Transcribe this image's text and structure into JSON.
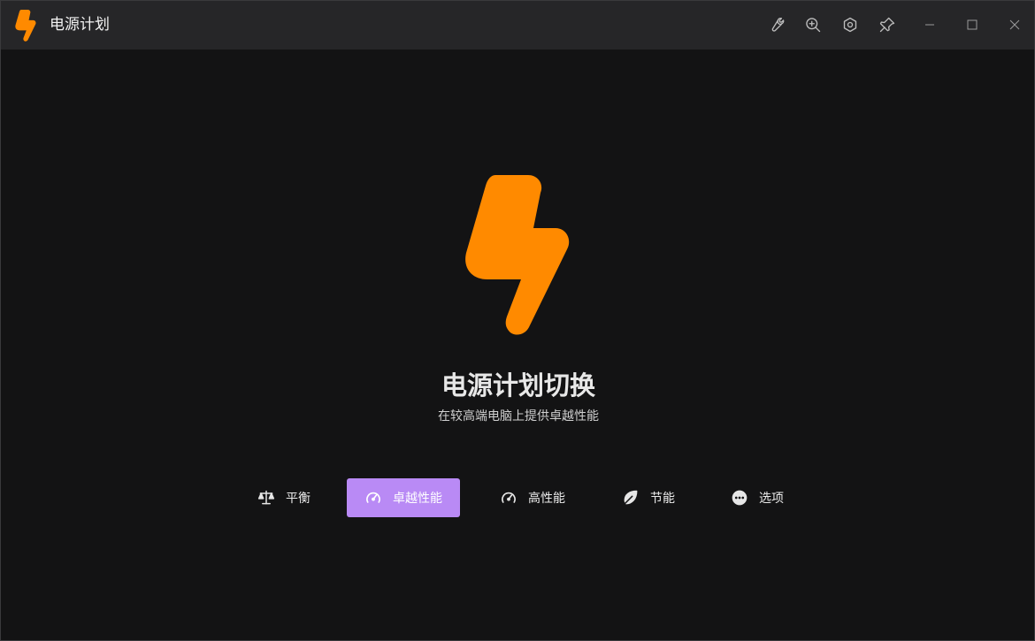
{
  "window": {
    "title": "电源计划",
    "toolbar_icons": [
      "wrench-icon",
      "zoom-in-icon",
      "settings-icon",
      "pin-icon"
    ],
    "controls": [
      "minimize-icon",
      "maximize-icon",
      "close-icon"
    ]
  },
  "hero": {
    "title": "电源计划切换",
    "subtitle": "在较高端电脑上提供卓越性能"
  },
  "plans": [
    {
      "label": "平衡",
      "icon": "balance-scale-icon",
      "active": false
    },
    {
      "label": "卓越性能",
      "icon": "gauge-icon",
      "active": true
    },
    {
      "label": "高性能",
      "icon": "gauge-icon",
      "active": false
    },
    {
      "label": "节能",
      "icon": "leaf-icon",
      "active": false
    },
    {
      "label": "选项",
      "icon": "more-options-icon",
      "active": false
    }
  ],
  "colors": {
    "brand": "#FF8A00",
    "accent": "#B98AF5",
    "titlebar": "#262628",
    "background": "#131314"
  }
}
